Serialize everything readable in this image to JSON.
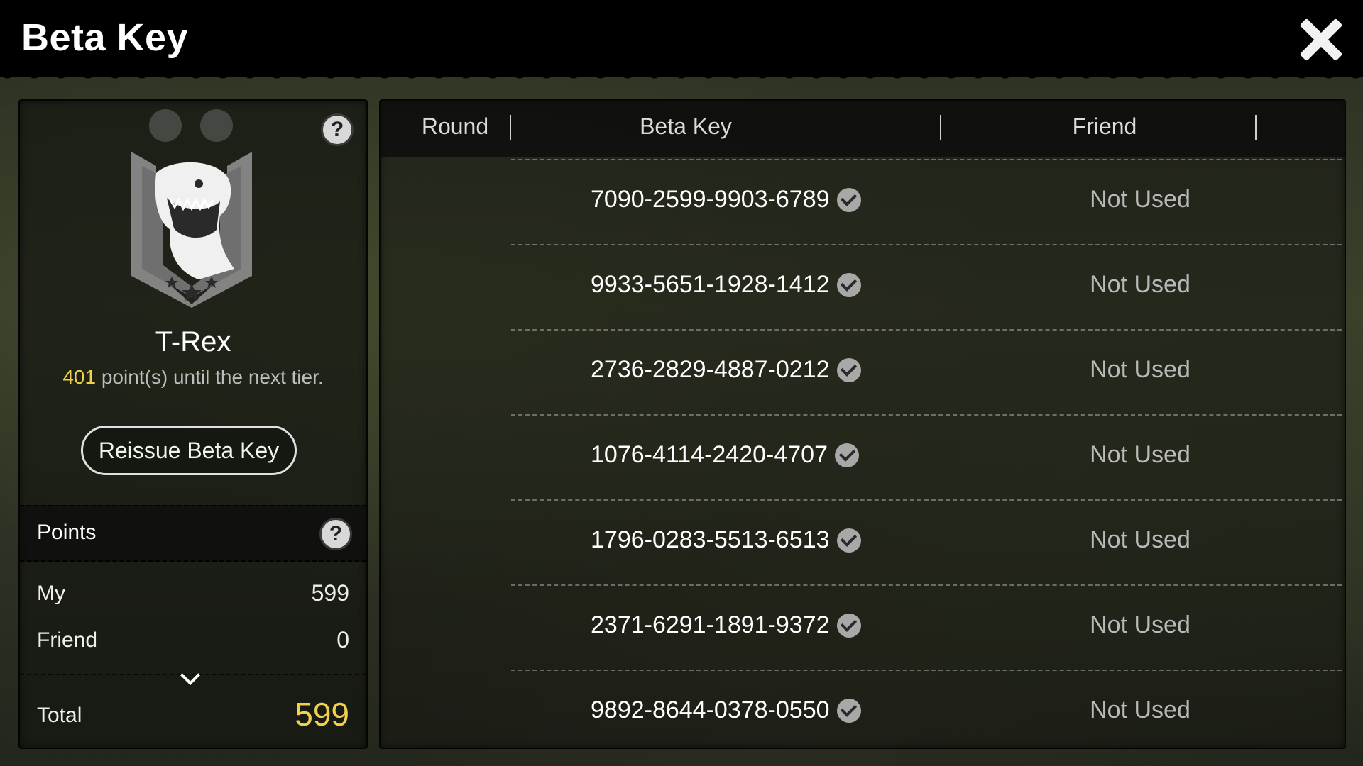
{
  "window": {
    "title": "Beta Key",
    "close_icon": "close-icon"
  },
  "profile": {
    "rank_name": "T-Rex",
    "points_to_next": "401",
    "points_to_next_suffix": "point(s) until the next tier.",
    "reissue_label": "Reissue Beta Key",
    "emblem_icon": "trex-shield-emblem"
  },
  "points": {
    "header": "Points",
    "rows": [
      {
        "label": "My",
        "value": "599"
      },
      {
        "label": "Friend",
        "value": "0"
      }
    ],
    "total_label": "Total",
    "total_value": "599"
  },
  "table": {
    "headers": {
      "round": "Round",
      "key": "Beta Key",
      "friend": "Friend"
    },
    "rows": [
      {
        "key": "7090-2599-9903-6789",
        "status": "Not Used"
      },
      {
        "key": "9933-5651-1928-1412",
        "status": "Not Used"
      },
      {
        "key": "2736-2829-4887-0212",
        "status": "Not Used"
      },
      {
        "key": "1076-4114-2420-4707",
        "status": "Not Used"
      },
      {
        "key": "1796-0283-5513-6513",
        "status": "Not Used"
      },
      {
        "key": "2371-6291-1891-9372",
        "status": "Not Used"
      },
      {
        "key": "9892-8644-0378-0550",
        "status": "Not Used"
      }
    ]
  },
  "colors": {
    "accent_yellow": "#f1d04a",
    "panel": "#141610",
    "topbar": "#000000"
  }
}
